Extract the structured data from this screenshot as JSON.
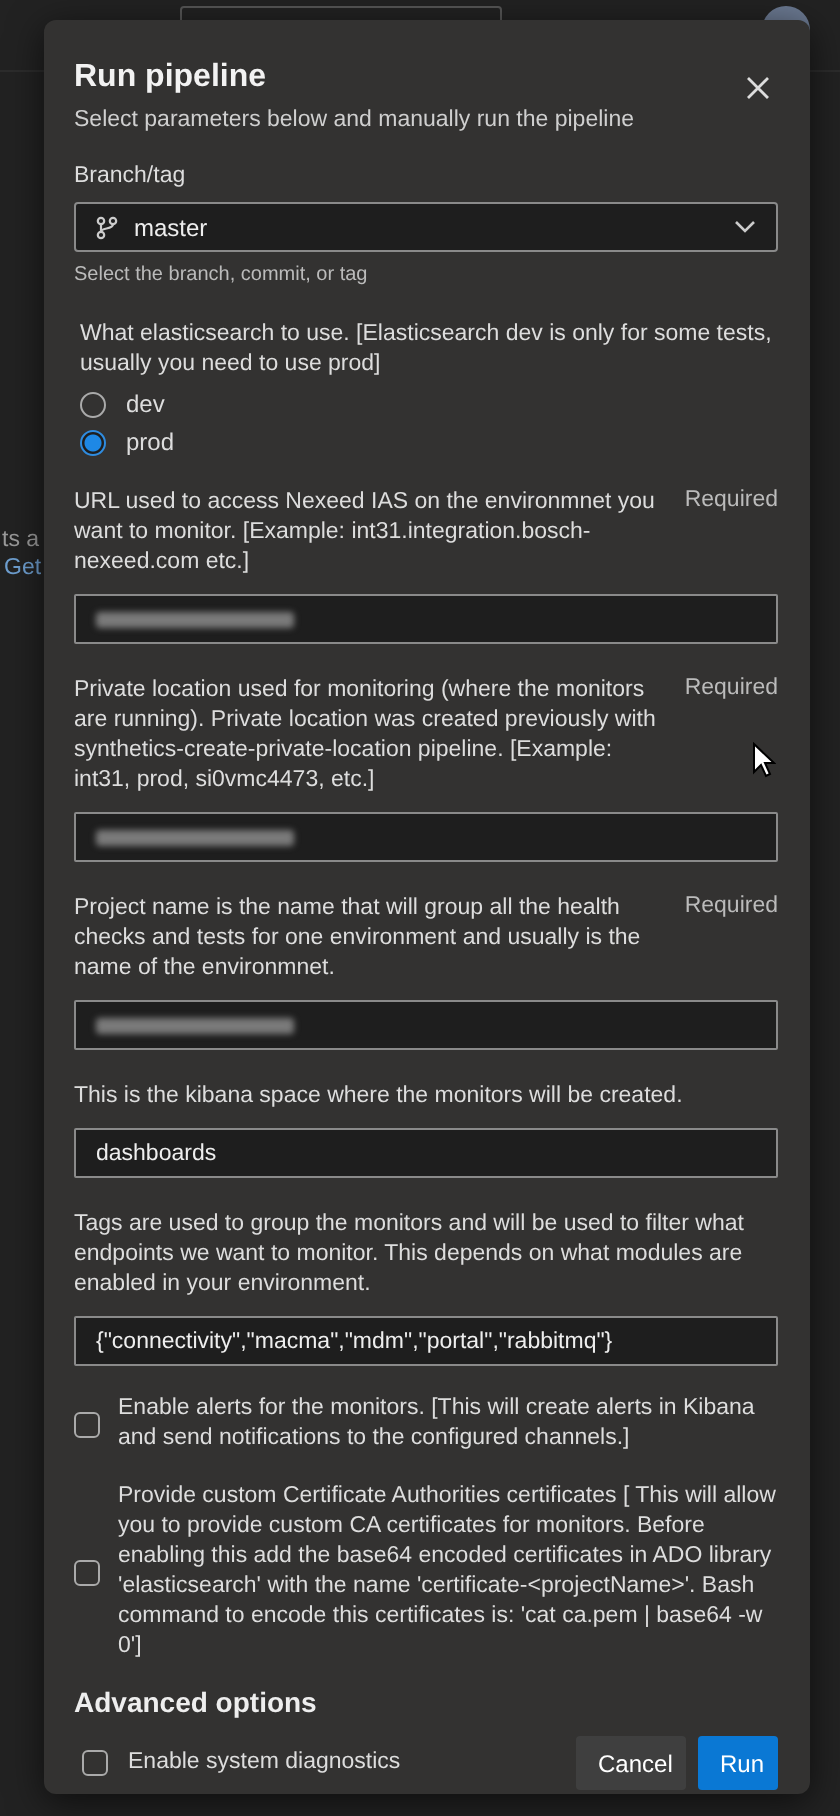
{
  "background": {
    "fragments": [
      "ts a",
      "Get"
    ]
  },
  "dialog": {
    "title": "Run pipeline",
    "subtitle": "Select parameters below and manually run the pipeline",
    "branch": {
      "label": "Branch/tag",
      "value": "master",
      "hint": "Select the branch, commit, or tag"
    },
    "parameters": [
      {
        "kind": "radio",
        "label": "What elasticsearch to use. [Elasticsearch dev is only for some tests, usually you need to use prod]",
        "options": [
          {
            "label": "dev",
            "selected": false
          },
          {
            "label": "prod",
            "selected": true
          }
        ]
      },
      {
        "kind": "text",
        "label": "URL used to access Nexeed IAS on the environmnet you want to monitor. [Example: int31.integration.bosch-nexeed.com etc.]",
        "required": "Required",
        "redacted": true
      },
      {
        "kind": "text",
        "label": "Private location used for monitoring (where the monitors are running). Private location was created previously with synthetics-create-private-location pipeline. [Example: int31, prod, si0vmc4473, etc.]",
        "required": "Required",
        "redacted": true
      },
      {
        "kind": "text",
        "label": "Project name is the name that will group all the health checks and tests for one environment and usually is the name of the environmnet.",
        "required": "Required",
        "redacted": true
      },
      {
        "kind": "text",
        "label": "This is the kibana space where the monitors will be created.",
        "value": "dashboards"
      },
      {
        "kind": "text",
        "label": "Tags are used to group the monitors and will be used to filter what endpoints we want to monitor. This depends on what modules are enabled in your environment.",
        "value": "{\"connectivity\",\"macma\",\"mdm\",\"portal\",\"rabbitmq\"}"
      },
      {
        "kind": "checkbox",
        "label": "Enable alerts for the monitors. [This will create alerts in Kibana and send notifications to the configured channels.]",
        "checked": false
      },
      {
        "kind": "checkbox",
        "label": "Provide custom Certificate Authorities certificates [ This will allow you to provide custom CA certificates for monitors. Before enabling this add the base64 encoded certificates in ADO library 'elasticsearch' with the name 'certificate-<projectName>'. Bash command to encode this certificates is: 'cat ca.pem | base64 -w 0']",
        "checked": false
      }
    ],
    "advanced": {
      "title": "Advanced options",
      "diagnostics": {
        "label": "Enable system diagnostics",
        "checked": false
      }
    },
    "buttons": [
      {
        "label": "Cancel",
        "kind": "secondary"
      },
      {
        "label": "Run",
        "kind": "primary"
      }
    ]
  }
}
